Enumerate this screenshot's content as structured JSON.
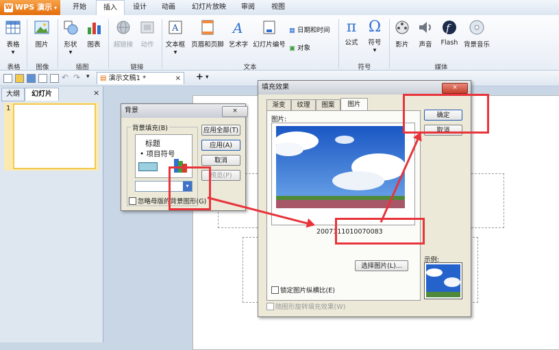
{
  "app": {
    "logo_text": "WPS 演示",
    "document_tab": "演示文稿1 *"
  },
  "menu_tabs": [
    "开始",
    "插入",
    "设计",
    "动画",
    "幻灯片放映",
    "审阅",
    "视图"
  ],
  "ribbon": {
    "buttons": [
      "表格",
      "图片",
      "形状",
      "图表",
      "超链接",
      "动作",
      "文本框",
      "页眉和页脚",
      "艺术字",
      "幻灯片编号",
      "日期和时间",
      "对象",
      "公式",
      "符号",
      "影片",
      "声音",
      "Flash",
      "背景音乐"
    ],
    "groups": [
      "表格",
      "图像",
      "插图",
      "链接",
      "文本",
      "符号",
      "媒体"
    ]
  },
  "left_panel": {
    "tabs": [
      "大纲",
      "幻灯片"
    ],
    "slide_number": "1"
  },
  "bg_dialog": {
    "title": "背景",
    "fieldset_label": "背景填充(B)",
    "preview_title": "标题",
    "preview_bullet": "• 项目符号",
    "buttons": [
      "应用全部(T)",
      "应用(A)",
      "取消",
      "预览(P)"
    ],
    "checkbox": "忽略母版的背景图形(G)"
  },
  "fill_dialog": {
    "title": "填充效果",
    "tabs": [
      "渐变",
      "纹理",
      "图案",
      "图片"
    ],
    "picture_label": "图片:",
    "filename": "2007111010070083",
    "ok": "确定",
    "cancel": "取消",
    "select_picture": "选择图片(L)...",
    "lock_aspect": "锁定图片纵横比(E)",
    "rotate_with_shape": "随图形旋转填充效果(W)",
    "sample_label": "示例:"
  },
  "colors": {
    "accent": "#e36c0a",
    "annotation_red": "#e8333a",
    "sky": "#2b6fd1"
  }
}
